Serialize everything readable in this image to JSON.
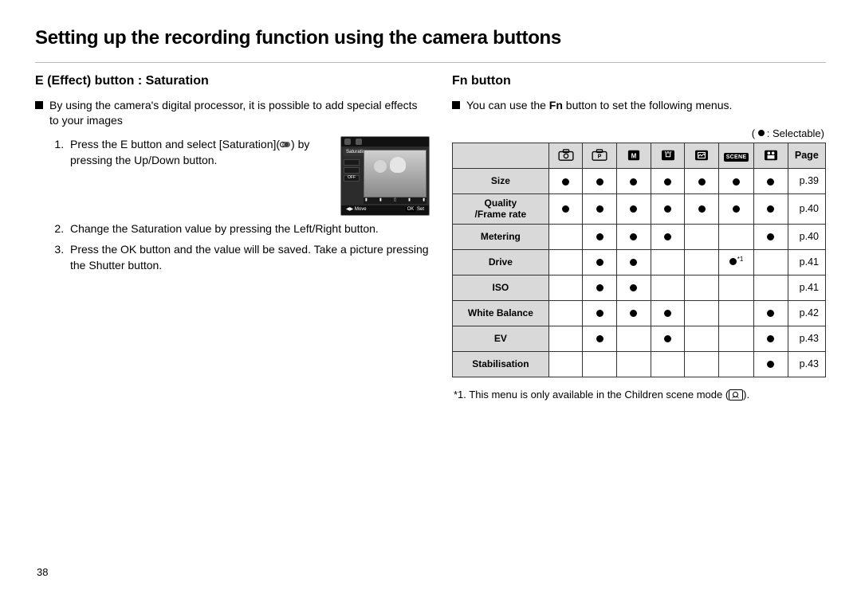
{
  "page_number": "38",
  "title": "Setting up the recording function using the camera buttons",
  "left": {
    "heading": "E (Effect) button : Saturation",
    "intro": "By using the camera's digital processor, it is possible to add special effects to your images",
    "steps_pre": "Press the E button and select [Saturation](",
    "steps_post": ") by pressing the Up/Down button.",
    "step2": "Change the Saturation value by pressing the Left/Right button.",
    "step3": "Press the OK button and the value will be saved. Take a picture pressing the Shutter button.",
    "lcd": {
      "label": "Saturation",
      "off": "OFF",
      "move": "Move",
      "ok": "OK",
      "set": "Set"
    }
  },
  "right": {
    "heading": "Fn button",
    "intro_pre": "You can use the ",
    "intro_bold": "Fn",
    "intro_post": " button to set the following menus.",
    "legend": ": Selectable)",
    "page_label": "Page",
    "rows": [
      {
        "label": "Size",
        "cells": [
          1,
          1,
          1,
          1,
          1,
          1,
          1
        ],
        "page": "p.39"
      },
      {
        "label": "Quality\n/Frame rate",
        "cells": [
          1,
          1,
          1,
          1,
          1,
          1,
          1
        ],
        "page": "p.40"
      },
      {
        "label": "Metering",
        "cells": [
          0,
          1,
          1,
          1,
          0,
          0,
          1
        ],
        "page": "p.40"
      },
      {
        "label": "Drive",
        "cells": [
          0,
          1,
          1,
          0,
          0,
          2,
          0
        ],
        "page": "p.41"
      },
      {
        "label": "ISO",
        "cells": [
          0,
          1,
          1,
          0,
          0,
          0,
          0
        ],
        "page": "p.41"
      },
      {
        "label": "White Balance",
        "cells": [
          0,
          1,
          1,
          1,
          0,
          0,
          1
        ],
        "page": "p.42"
      },
      {
        "label": "EV",
        "cells": [
          0,
          1,
          0,
          1,
          0,
          0,
          1
        ],
        "page": "p.43"
      },
      {
        "label": "Stabilisation",
        "cells": [
          0,
          0,
          0,
          0,
          0,
          0,
          1
        ],
        "page": "p.43"
      }
    ],
    "scene_text": "SCENE",
    "footnote_pre": "*1. This menu is only available in the Children scene mode (",
    "footnote_post": ").",
    "footnote_star": "*1"
  }
}
